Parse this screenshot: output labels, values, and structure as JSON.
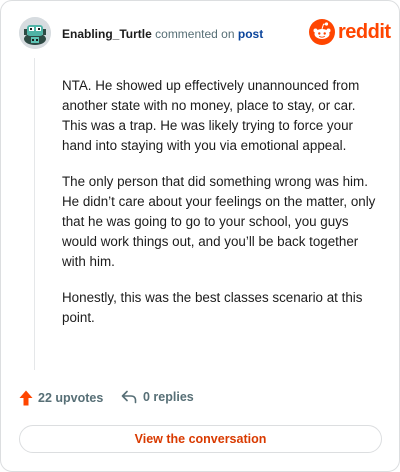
{
  "header": {
    "author": "Enabling_Turtle",
    "action": "commented on",
    "link": "post",
    "brand": "reddit"
  },
  "comment": {
    "paragraphs": [
      "NTA. He showed up effectively unannounced from another state with no money, place to stay, or car. This was a trap. He was likely trying to force your hand into staying with you via emotional appeal.",
      "The only person that did something wrong was him. He didn’t care about your feelings on the matter, only that he was going to go to your school, you guys would work things out, and you’ll be back together with him.",
      "Honestly, this was the best classes scenario at this point."
    ]
  },
  "actions": {
    "upvotes": "22 upvotes",
    "replies": "0 replies"
  },
  "cta": "View the conversation",
  "colors": {
    "brand": "#ff4500",
    "upvote": "#ff4500",
    "cta_text": "#d93a00",
    "link": "#0a449b"
  },
  "icons": [
    "turtle-avatar-icon",
    "reddit-snoo-icon",
    "upvote-arrow-icon",
    "reply-icon"
  ]
}
